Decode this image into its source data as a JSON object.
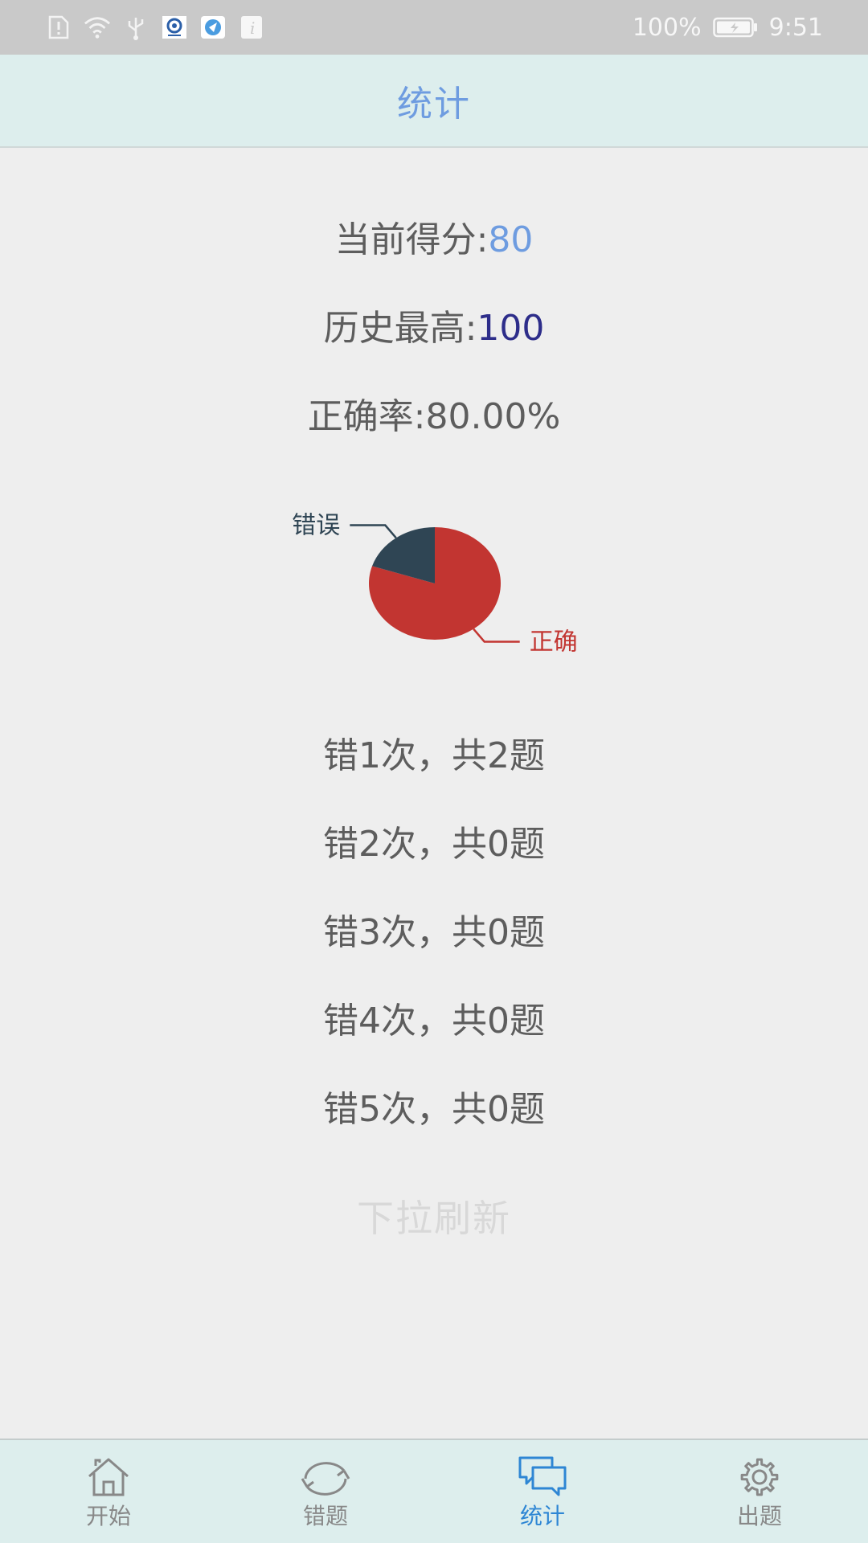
{
  "status_bar": {
    "battery": "100%",
    "time": "9:51"
  },
  "header": {
    "title": "统计"
  },
  "stats": {
    "current_score_label": "当前得分:",
    "current_score_value": "80",
    "best_score_label": "历史最高:",
    "best_score_value": "100",
    "accuracy_label": "正确率:",
    "accuracy_value": "80.00%"
  },
  "chart_data": {
    "type": "pie",
    "slices": [
      {
        "label": "正确",
        "value": 80,
        "color": "#c23531"
      },
      {
        "label": "错误",
        "value": 20,
        "color": "#2f4554"
      }
    ]
  },
  "wrong_counts": [
    {
      "text": "错1次，共2题"
    },
    {
      "text": "错2次，共0题"
    },
    {
      "text": "错3次，共0题"
    },
    {
      "text": "错4次，共0题"
    },
    {
      "text": "错5次，共0题"
    }
  ],
  "refresh_hint": "下拉刷新",
  "bottom_nav": {
    "items": [
      {
        "label": "开始",
        "icon": "home-icon",
        "active": false
      },
      {
        "label": "错题",
        "icon": "refresh-icon",
        "active": false
      },
      {
        "label": "统计",
        "icon": "chat-icon",
        "active": true
      },
      {
        "label": "出题",
        "icon": "gear-icon",
        "active": false
      }
    ]
  },
  "colors": {
    "accent": "#6e9ce0",
    "best_score": "#2d2d8a",
    "nav_active": "#2e86d4",
    "header_bg": "#ddeeed"
  }
}
